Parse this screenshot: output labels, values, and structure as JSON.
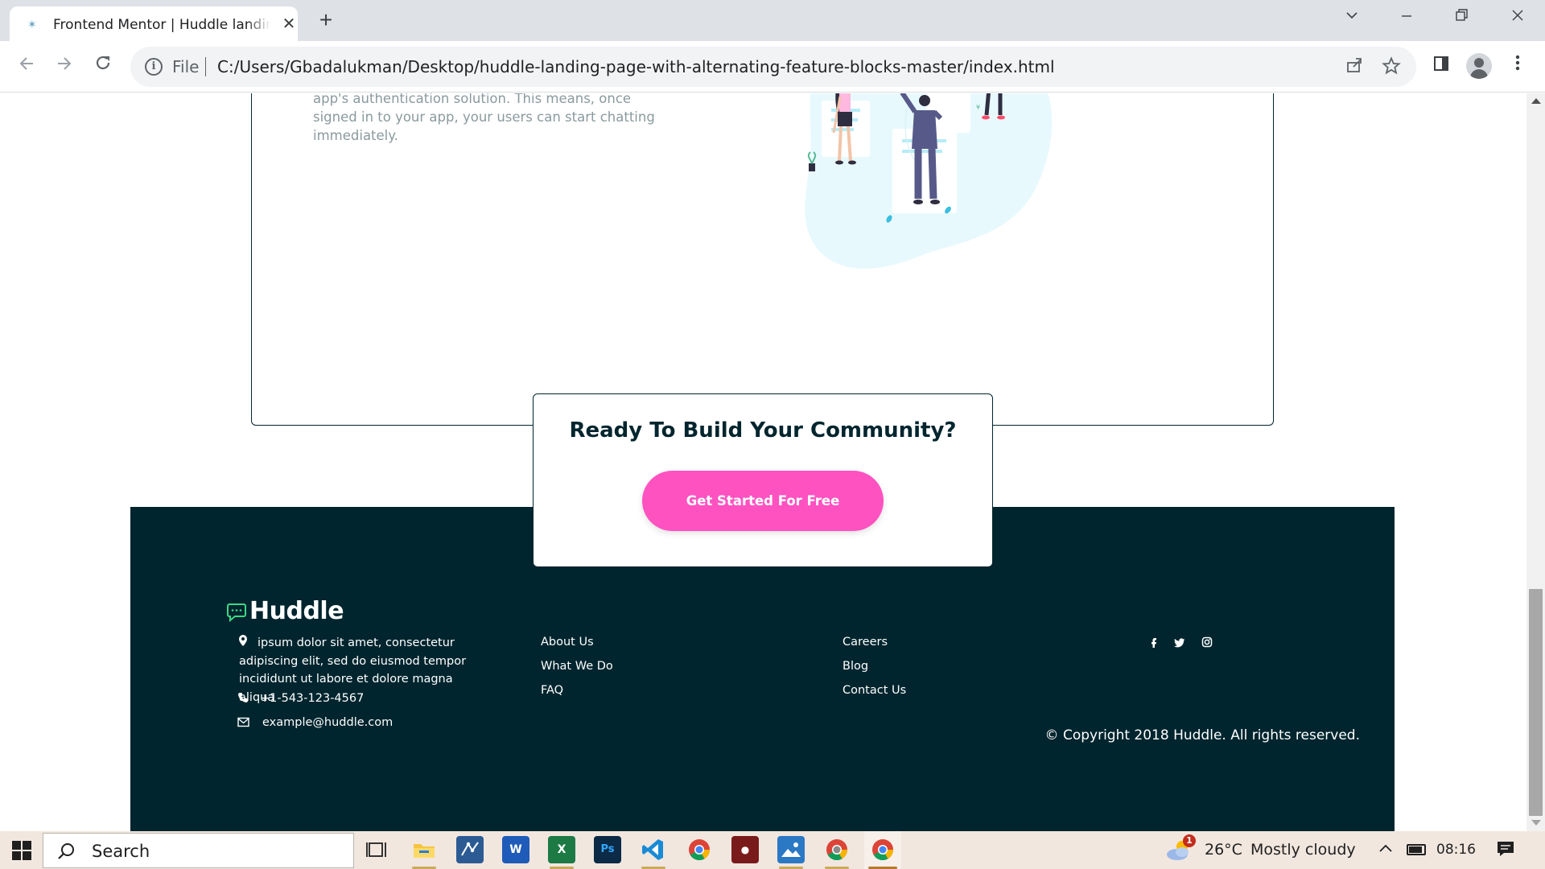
{
  "browser": {
    "tab_title": "Frontend Mentor | Huddle landing page with alternating feature blocks",
    "tab_close": "✕",
    "new_tab": "+",
    "scheme_label": "File",
    "url": "C:/Users/Gbadalukman/Desktop/huddle-landing-page-with-alternating-feature-blocks-master/index.html"
  },
  "page": {
    "feature_text": "It takes no time at all to integrate Huddle with your app's authentication solution. This means, once signed in to your app, your users can start chatting immediately.",
    "cta": {
      "title": "Ready To Build Your Community?",
      "button_label": "Get Started For Free"
    },
    "footer": {
      "logo_text": "Huddle",
      "address": "ipsum dolor sit amet, consectetur adipiscing elit, sed do eiusmod tempor incididunt ut labore et dolore magna aliqua",
      "phone": "+1-543-123-4567",
      "email": "example@huddle.com",
      "links_col1": [
        "About Us",
        "What We Do",
        "FAQ"
      ],
      "links_col2": [
        "Careers",
        "Blog",
        "Contact Us"
      ],
      "social_icons": [
        "facebook-icon",
        "twitter-icon",
        "instagram-icon"
      ],
      "copyright": "© Copyright 2018 Huddle. All rights reserved."
    },
    "colors": {
      "dark_blue": "#00252e",
      "pink": "#ff52c1",
      "grey_text": "#8a9a9e"
    }
  },
  "taskbar": {
    "search_label": "Search",
    "apps": [
      "task-view",
      "file-explorer",
      "network-app",
      "word",
      "excel",
      "photoshop",
      "vscode",
      "chrome",
      "screen-recorder",
      "photos",
      "chrome-alt",
      "chrome-active"
    ],
    "weather_badge": "1",
    "weather_temp": "26°C",
    "weather_desc": "Mostly cloudy",
    "clock": "08:16"
  }
}
